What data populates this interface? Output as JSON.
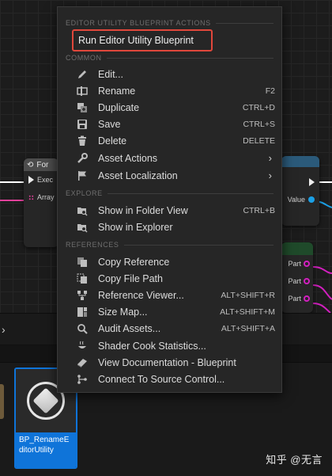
{
  "graph": {
    "node_left": {
      "title": "For",
      "exec_label": "Exec",
      "array_label": "Array"
    },
    "node_right": {
      "value_label": "Value"
    },
    "node_right2": {
      "pins": [
        "Part",
        "Part",
        "Part"
      ]
    }
  },
  "colors": {
    "accent_selection": "#0f74d9",
    "highlight_border": "#e0473b",
    "menu_bg": "#262626",
    "exec_wire": "#ffffff",
    "array_wire": "#e0409a"
  },
  "menu": {
    "sections": {
      "editor_utility": "EDITOR UTILITY BLUEPRINT ACTIONS",
      "common": "COMMON",
      "explore": "EXPLORE",
      "references": "REFERENCES"
    },
    "run_label": "Run Editor Utility Blueprint",
    "common_items": [
      {
        "label": "Edit...",
        "shortcut": "",
        "icon": "pencil-icon"
      },
      {
        "label": "Rename",
        "shortcut": "F2",
        "icon": "rename-icon"
      },
      {
        "label": "Duplicate",
        "shortcut": "CTRL+D",
        "icon": "duplicate-icon"
      },
      {
        "label": "Save",
        "shortcut": "CTRL+S",
        "icon": "save-icon"
      },
      {
        "label": "Delete",
        "shortcut": "DELETE",
        "icon": "trash-icon"
      },
      {
        "label": "Asset Actions",
        "shortcut": "",
        "icon": "wrench-icon"
      },
      {
        "label": "Asset Localization",
        "shortcut": "",
        "icon": "flag-icon"
      }
    ],
    "explore_items": [
      {
        "label": "Show in Folder View",
        "shortcut": "CTRL+B",
        "icon": "folder-search-icon"
      },
      {
        "label": "Show in Explorer",
        "shortcut": "",
        "icon": "folder-search-icon"
      }
    ],
    "reference_items": [
      {
        "label": "Copy Reference",
        "shortcut": "",
        "icon": "copy-icon"
      },
      {
        "label": "Copy File Path",
        "shortcut": "",
        "icon": "copy-icon"
      },
      {
        "label": "Reference Viewer...",
        "shortcut": "ALT+SHIFT+R",
        "icon": "reference-viewer-icon"
      },
      {
        "label": "Size Map...",
        "shortcut": "ALT+SHIFT+M",
        "icon": "size-map-icon"
      },
      {
        "label": "Audit Assets...",
        "shortcut": "ALT+SHIFT+A",
        "icon": "audit-icon"
      },
      {
        "label": "Shader Cook Statistics...",
        "shortcut": "",
        "icon": "shader-icon"
      },
      {
        "label": "View Documentation - Blueprint",
        "shortcut": "",
        "icon": "documentation-icon"
      },
      {
        "label": "Connect To Source Control...",
        "shortcut": "",
        "icon": "source-control-icon"
      }
    ]
  },
  "browser": {
    "asset_name": "BP_RenameEditorUtility"
  },
  "watermark": "知乎 @无言"
}
